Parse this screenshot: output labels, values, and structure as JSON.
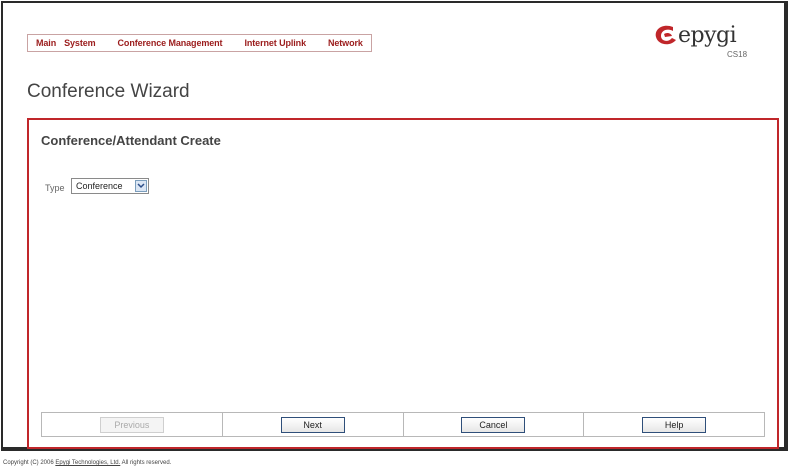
{
  "menu": {
    "items": [
      "Main",
      "System",
      "Conference Management",
      "Internet Uplink",
      "Network"
    ]
  },
  "logo": {
    "brand": "epygi",
    "model": "CS18"
  },
  "page": {
    "title": "Conference Wizard"
  },
  "panel": {
    "title": "Conference/Attendant Create",
    "type_label": "Type",
    "type_value": "Conference"
  },
  "buttons": {
    "previous": "Previous",
    "next": "Next",
    "cancel": "Cancel",
    "help": "Help"
  },
  "footer": {
    "prefix": "Copyright (C) 2006 ",
    "company": "Epygi Technologies, Ltd.",
    "suffix": " All rights reserved."
  },
  "colors": {
    "accent": "#c0262a",
    "menu_text": "#9b1c1c"
  }
}
